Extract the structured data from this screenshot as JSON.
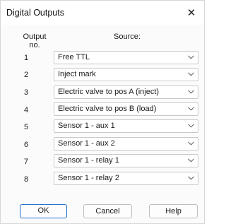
{
  "window": {
    "title": "Digital Outputs"
  },
  "headers": {
    "output_line1": "Output",
    "output_line2": "no.",
    "source": "Source:"
  },
  "rows": [
    {
      "num": "1",
      "source": "Free TTL"
    },
    {
      "num": "2",
      "source": "Inject mark"
    },
    {
      "num": "3",
      "source": "Electric valve to pos A (inject)"
    },
    {
      "num": "4",
      "source": "Electric valve to pos B (load)"
    },
    {
      "num": "5",
      "source": "Sensor 1 - aux 1"
    },
    {
      "num": "6",
      "source": "Sensor 1 - aux 2"
    },
    {
      "num": "7",
      "source": "Sensor 1 - relay 1"
    },
    {
      "num": "8",
      "source": "Sensor 1 - relay 2"
    }
  ],
  "buttons": {
    "ok": "OK",
    "cancel": "Cancel",
    "help": "Help"
  },
  "icons": {
    "close": "close-icon",
    "dropdown": "chevron-down-icon"
  },
  "colors": {
    "default_button_border": "#1f6fcf"
  }
}
